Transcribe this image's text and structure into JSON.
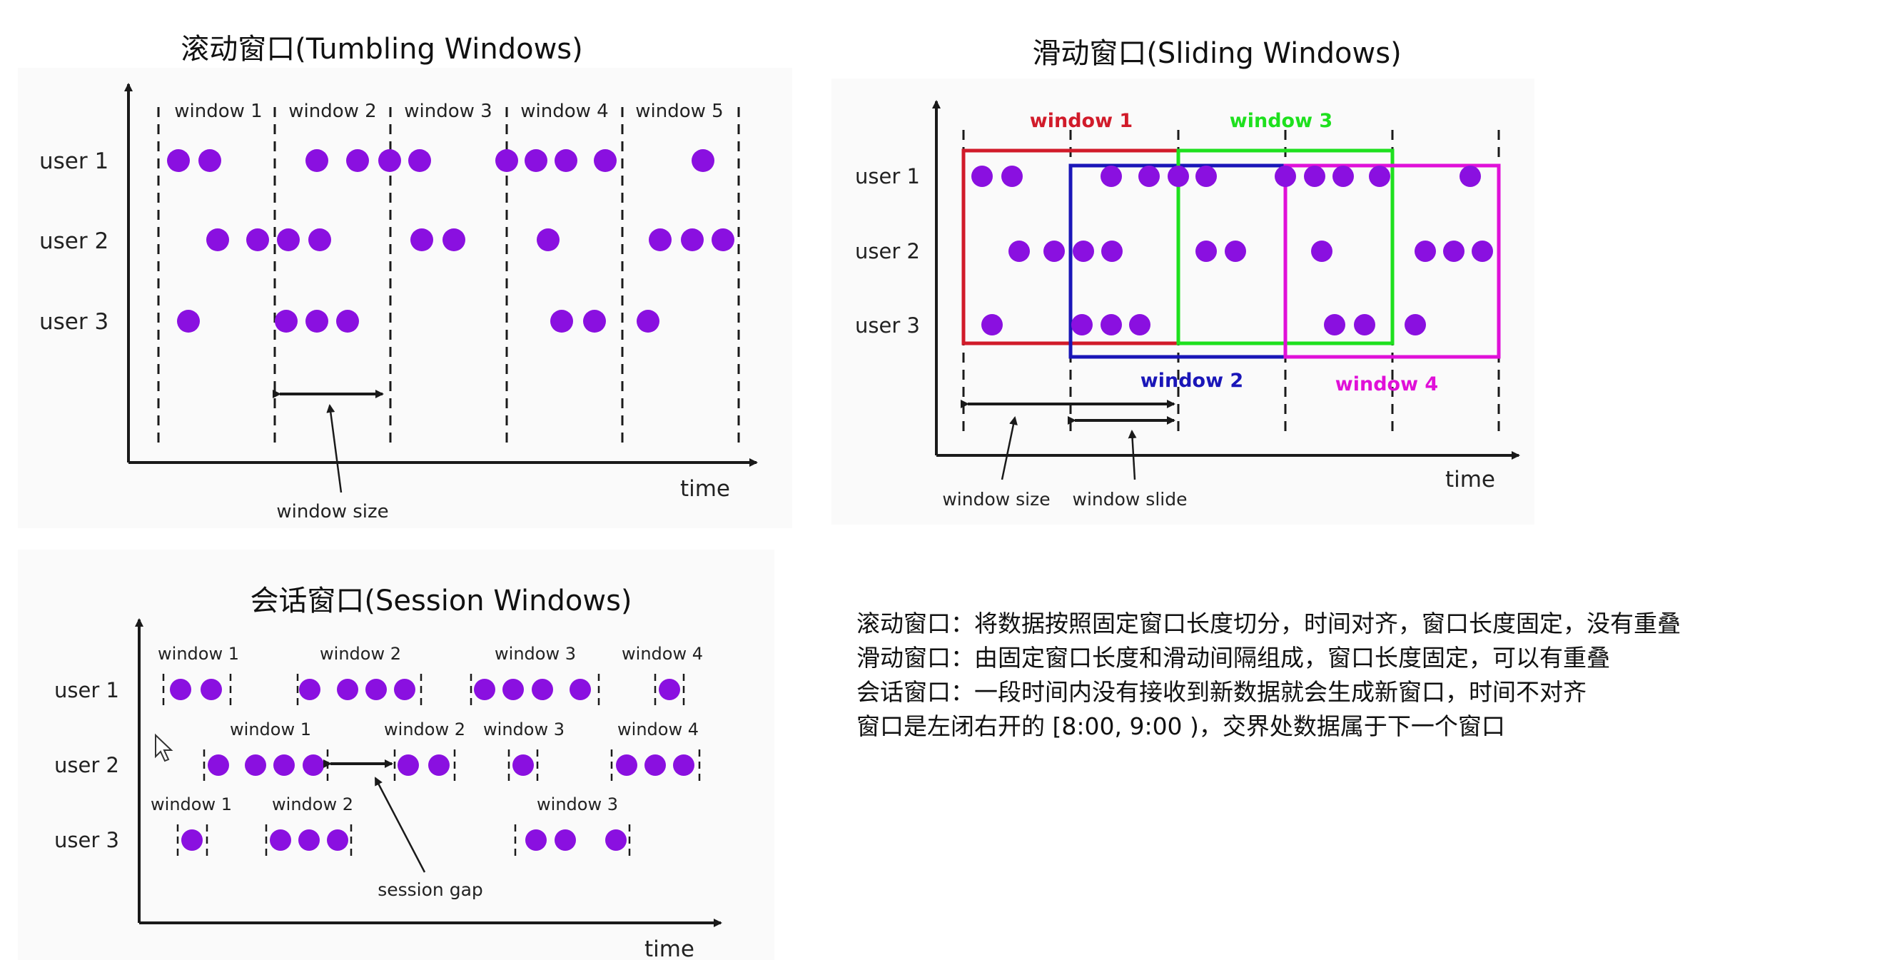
{
  "colors": {
    "dot": "#8a10e0",
    "axis": "#1a1a1a",
    "text": "#222222",
    "panel": "#fafafa",
    "red": "#d11b2a",
    "green": "#1ee01e",
    "blue": "#1a16b8",
    "magenta": "#e010d8"
  },
  "tumbling": {
    "title": "滚动窗口(Tumbling Windows)",
    "users": [
      "user 1",
      "user 2",
      "user 3"
    ],
    "windows": [
      "window 1",
      "window 2",
      "window 3",
      "window 4",
      "window 5"
    ],
    "size_label": "window size",
    "time_label": "time"
  },
  "sliding": {
    "title": "滑动窗口(Sliding Windows)",
    "users": [
      "user 1",
      "user 2",
      "user 3"
    ],
    "windows": [
      "window 1",
      "window 2",
      "window 3",
      "window 4"
    ],
    "size_label": "window size",
    "slide_label": "window slide",
    "time_label": "time"
  },
  "session": {
    "title": "会话窗口(Session Windows)",
    "users": [
      "user 1",
      "user 2",
      "user 3"
    ],
    "windows_user1": [
      "window 1",
      "window 2",
      "window 3",
      "window 4"
    ],
    "windows_user2": [
      "window 1",
      "window 2",
      "window 3",
      "window 4"
    ],
    "windows_user3": [
      "window 1",
      "window 2",
      "window 3"
    ],
    "gap_label": "session gap",
    "time_label": "time"
  },
  "notes": [
    "滚动窗口：将数据按照固定窗口长度切分，时间对齐，窗口长度固定，没有重叠",
    "滑动窗口：由固定窗口长度和滑动间隔组成，窗口长度固定，可以有重叠",
    "会话窗口：一段时间内没有接收到新数据就会生成新窗口，时间不对齐",
    "窗口是左闭右开的 [8:00, 9:00 )，交界处数据属于下一个窗口"
  ]
}
